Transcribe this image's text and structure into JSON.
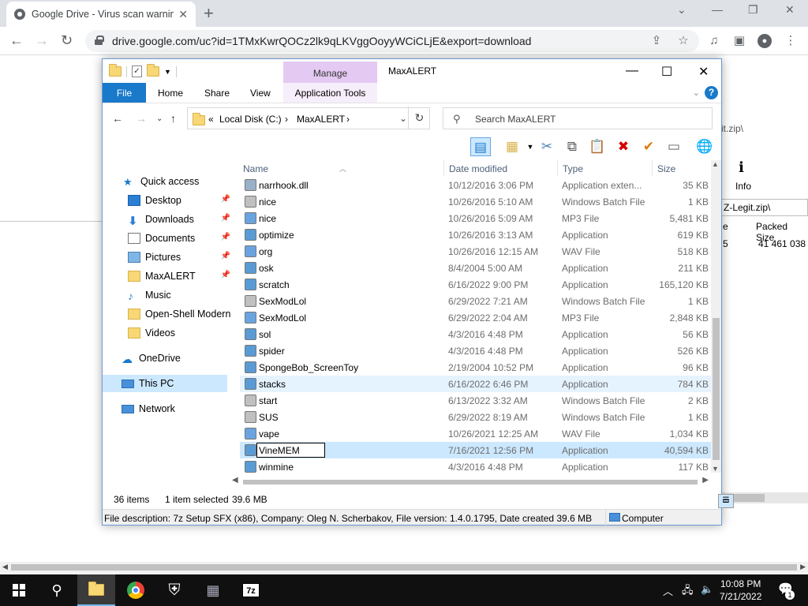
{
  "browser": {
    "tab_title": "Google Drive - Virus scan warnin",
    "url": "drive.google.com/uc?id=1TMxKwrQOCz2lk9qLKVggOoyyWCiCLjE&export=download"
  },
  "bg_7zip": {
    "path_top": "it.zip\\",
    "info_label": "Info",
    "path_bar": "Z-Legit.zip\\",
    "col_partial": "e",
    "col_packed": "Packed Size",
    "row_partial": "5",
    "row_packed": "41 461 038"
  },
  "explorer": {
    "title": "MaxALERT",
    "manage_label": "Manage",
    "ribbon_tabs": {
      "file": "File",
      "home": "Home",
      "share": "Share",
      "view": "View",
      "app_tools": "Application Tools"
    },
    "address": {
      "prefix": "«",
      "crumb1": "Local Disk (C:)",
      "crumb2": "MaxALERT",
      "sep": "›"
    },
    "search_placeholder": "Search MaxALERT",
    "nav": [
      {
        "label": "Quick access"
      },
      {
        "label": "Desktop"
      },
      {
        "label": "Downloads"
      },
      {
        "label": "Documents"
      },
      {
        "label": "Pictures"
      },
      {
        "label": "MaxALERT"
      },
      {
        "label": "Music"
      },
      {
        "label": "Open-Shell Modern"
      },
      {
        "label": "Videos"
      },
      {
        "label": "OneDrive"
      },
      {
        "label": "This PC"
      },
      {
        "label": "Network"
      }
    ],
    "columns": {
      "name": "Name",
      "date": "Date modified",
      "type": "Type",
      "size": "Size"
    },
    "files": [
      {
        "name": "narrhook.dll",
        "date": "10/12/2016 3:06 PM",
        "type": "Application exten...",
        "size": "35 KB"
      },
      {
        "name": "nice",
        "date": "10/26/2016 5:10 AM",
        "type": "Windows Batch File",
        "size": "1 KB"
      },
      {
        "name": "nice",
        "date": "10/26/2016 5:09 AM",
        "type": "MP3 File",
        "size": "5,481 KB"
      },
      {
        "name": "optimize",
        "date": "10/26/2016 3:13 AM",
        "type": "Application",
        "size": "619 KB"
      },
      {
        "name": "org",
        "date": "10/26/2016 12:15 AM",
        "type": "WAV File",
        "size": "518 KB"
      },
      {
        "name": "osk",
        "date": "8/4/2004 5:00 AM",
        "type": "Application",
        "size": "211 KB"
      },
      {
        "name": "scratch",
        "date": "6/16/2022 9:00 PM",
        "type": "Application",
        "size": "165,120 KB"
      },
      {
        "name": "SexModLol",
        "date": "6/29/2022 7:21 AM",
        "type": "Windows Batch File",
        "size": "1 KB"
      },
      {
        "name": "SexModLol",
        "date": "6/29/2022 2:04 AM",
        "type": "MP3 File",
        "size": "2,848 KB"
      },
      {
        "name": "sol",
        "date": "4/3/2016 4:48 PM",
        "type": "Application",
        "size": "56 KB"
      },
      {
        "name": "spider",
        "date": "4/3/2016 4:48 PM",
        "type": "Application",
        "size": "526 KB"
      },
      {
        "name": "SpongeBob_ScreenToy",
        "date": "2/19/2004 10:52 PM",
        "type": "Application",
        "size": "96 KB"
      },
      {
        "name": "stacks",
        "date": "6/16/2022 6:46 PM",
        "type": "Application",
        "size": "784 KB"
      },
      {
        "name": "start",
        "date": "6/13/2022 3:32 AM",
        "type": "Windows Batch File",
        "size": "2 KB"
      },
      {
        "name": "SUS",
        "date": "6/29/2022 8:19 AM",
        "type": "Windows Batch File",
        "size": "1 KB"
      },
      {
        "name": "vape",
        "date": "10/26/2021 12:25 AM",
        "type": "WAV File",
        "size": "1,034 KB"
      },
      {
        "name": "VineMEM",
        "date": "7/16/2021 12:56 PM",
        "type": "Application",
        "size": "40,594 KB"
      },
      {
        "name": "winmine",
        "date": "4/3/2016 4:48 PM",
        "type": "Application",
        "size": "117 KB"
      }
    ],
    "status": {
      "items": "36 items",
      "selected": "1 item selected",
      "selsize": "39.6 MB"
    },
    "description": "File description: 7z Setup SFX (x86), Company: Oleg N. Scherbakov, File version: 1.4.0.1795, Date created 39.6 MB",
    "computer_label": "Computer"
  },
  "taskbar": {
    "time": "10:08 PM",
    "date": "7/21/2022",
    "app_7z": "7z",
    "notif_count": "1"
  }
}
